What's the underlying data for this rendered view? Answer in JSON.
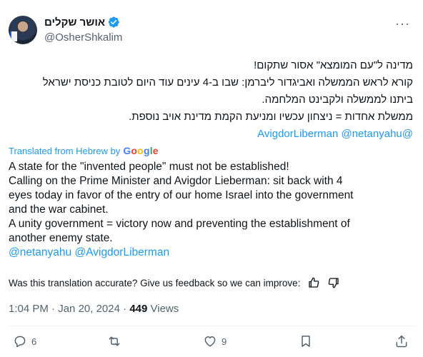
{
  "author": {
    "display_name": "אושר שקלים",
    "handle": "@OsherShkalim"
  },
  "more_label": "···",
  "tweet_hebrew": {
    "line1": "מדינה ל\"עם המומצא\" אסור שתקום!",
    "line2": "קורא לראש הממשלה ואביגדור ליברמן: שבו ב-4 עינים עוד היום לטובת כניסת ישראל",
    "line3": "ביתנו לממשלה ולקבינט המלחמה.",
    "line4": "ממשלת אחדות = ניצחון עכשיו ומניעת  הקמת מדינת אויב נוספת.",
    "mention_a": "@AvigdorLiberman",
    "mention_b": "@netanyahu"
  },
  "translation": {
    "label": "Translated from Hebrew by",
    "provider": [
      "G",
      "o",
      "o",
      "g",
      "l",
      "e"
    ],
    "line1": "A state for the \"invented people\" must not be established!",
    "line2": "Calling on the Prime Minister and Avigdor Lieberman: sit back with 4",
    "line3": "eyes today in favor of the entry of our home Israel into the government",
    "line4": "and the war cabinet.",
    "line5": "A unity government = victory now and preventing the establishment of",
    "line6": "another enemy state.",
    "mention_a": "@netanyahu",
    "mention_b": "@AvigdorLiberman"
  },
  "feedback": {
    "question": "Was this translation accurate? Give us feedback so we can improve:"
  },
  "meta": {
    "time": "1:04 PM",
    "separator": "·",
    "date": "Jan 20, 2024",
    "views_count": "449",
    "views_label": "Views"
  },
  "actions": {
    "replies": "6",
    "retweets": "",
    "likes": "9"
  },
  "colors": {
    "link": "#1d9bf0",
    "verified": "#1d9bf0",
    "muted": "#536471",
    "text": "#0f1419"
  }
}
